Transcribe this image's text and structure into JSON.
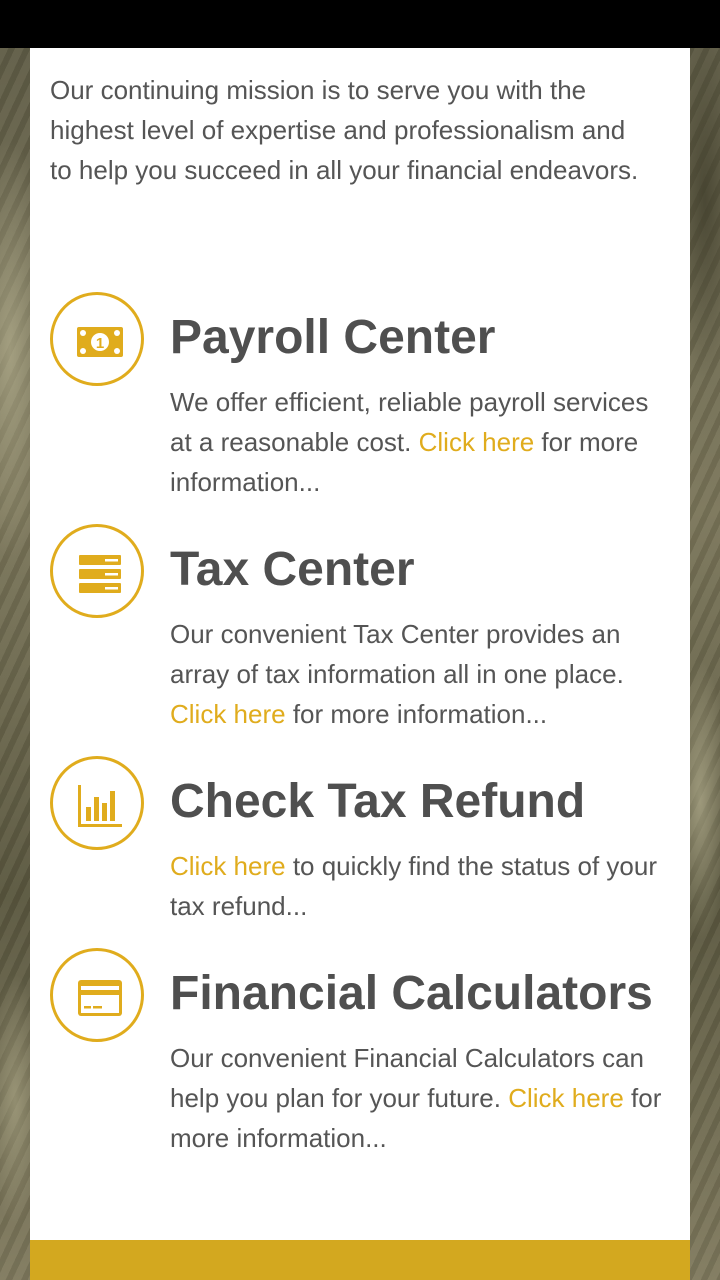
{
  "intro": "Our continuing mission is to serve you with the highest level of expertise and professionalism and to help you succeed in all your financial endeavors.",
  "colors": {
    "accent": "#e0ac1d",
    "text": "#555555",
    "heading": "#4f4f4f",
    "footer": "#d3a81f"
  },
  "services": [
    {
      "icon": "money-bill-icon",
      "title": "Payroll Center",
      "desc_before": "We offer efficient, reliable payroll services at a reasonable cost. ",
      "link": "Click here",
      "desc_after": " for more information..."
    },
    {
      "icon": "server-list-icon",
      "title": "Tax Center",
      "desc_before": "Our convenient Tax Center provides an array of tax information all in one place. ",
      "link": "Click here",
      "desc_after": " for more information..."
    },
    {
      "icon": "bar-chart-icon",
      "title": "Check Tax Refund",
      "desc_before": "",
      "link": "Click here",
      "desc_after": " to quickly find the status of your tax refund..."
    },
    {
      "icon": "credit-card-icon",
      "title": "Financial Calculators",
      "desc_before": "Our convenient Financial Calculators can help you plan for your future. ",
      "link": "Click here",
      "desc_after": " for more information..."
    }
  ]
}
